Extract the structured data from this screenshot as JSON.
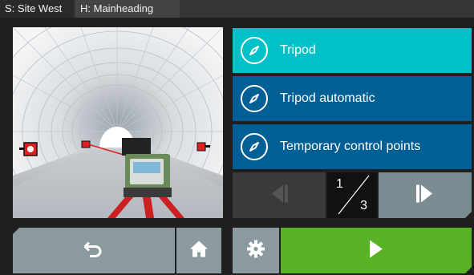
{
  "status_bar": {
    "site": "S: Site West",
    "heading": "H: Mainheading"
  },
  "options": [
    {
      "label": "Tripod",
      "icon": "compass-icon",
      "selected": true
    },
    {
      "label": "Tripod automatic",
      "icon": "compass-icon",
      "selected": false
    },
    {
      "label": "Temporary control points",
      "icon": "compass-icon",
      "selected": false
    }
  ],
  "pager": {
    "current": "1",
    "total": "3",
    "prev_icon": "skip-back-icon",
    "next_icon": "skip-forward-icon",
    "prev_enabled": false
  },
  "toolbar": {
    "back_icon": "back-arrow-icon",
    "home_icon": "home-icon",
    "settings_icon": "gear-icon",
    "play_icon": "play-icon"
  },
  "colors": {
    "selected": "#00c0c8",
    "option": "#005f95",
    "button": "#8a9a9f",
    "play": "#59b226",
    "background": "#1f1f1f"
  }
}
